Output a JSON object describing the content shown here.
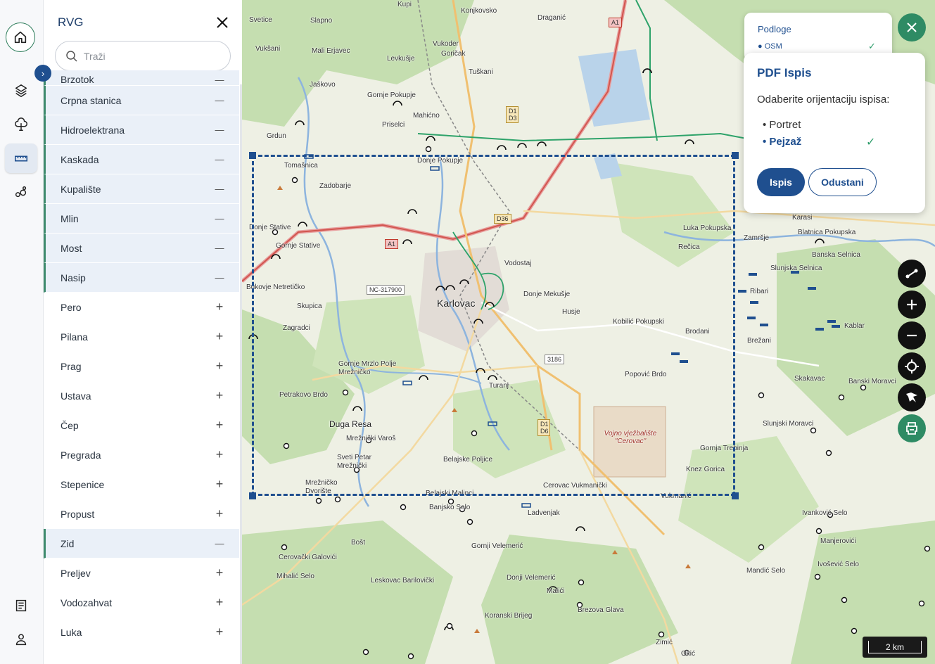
{
  "panel": {
    "title": "RVG",
    "search_placeholder": "Traži",
    "items": [
      {
        "label": "Brzotok",
        "active": true
      },
      {
        "label": "Crpna stanica",
        "active": true
      },
      {
        "label": "Hidroelektrana",
        "active": true
      },
      {
        "label": "Kaskada",
        "active": true
      },
      {
        "label": "Kupalište",
        "active": true
      },
      {
        "label": "Mlin",
        "active": true
      },
      {
        "label": "Most",
        "active": true
      },
      {
        "label": "Nasip",
        "active": true
      },
      {
        "label": "Pero",
        "active": false
      },
      {
        "label": "Pilana",
        "active": false
      },
      {
        "label": "Prag",
        "active": false
      },
      {
        "label": "Ustava",
        "active": false
      },
      {
        "label": "Čep",
        "active": false
      },
      {
        "label": "Pregrada",
        "active": false
      },
      {
        "label": "Stepenice",
        "active": false
      },
      {
        "label": "Propust",
        "active": false
      },
      {
        "label": "Zid",
        "active": true
      },
      {
        "label": "Preljev",
        "active": false
      },
      {
        "label": "Vodozahvat",
        "active": false
      },
      {
        "label": "Luka",
        "active": false
      }
    ]
  },
  "layers": {
    "title": "Podloge",
    "item": "OSM"
  },
  "pdf": {
    "title": "PDF Ispis",
    "question": "Odaberite orijentaciju ispisa:",
    "option_portrait": "• Portret",
    "option_landscape": "• Pejzaž",
    "selected": "Pejzaž",
    "print_button": "Ispis",
    "cancel_button": "Odustani"
  },
  "map": {
    "scale": "2 km",
    "places": {
      "karlovac": "Karlovac",
      "duga_resa": "Duga Resa",
      "turanj": "Turanj",
      "donje_pokupje": "Donje Pokupje",
      "gornje_pokupje": "Gornje Pokupje",
      "tomasnica": "Tomašnica",
      "zadobarje": "Zadobarje",
      "donje_stative": "Donje Stative",
      "gornje_stative": "Gornje Stative",
      "bukovje": "Bukovje Netretičko",
      "skupica": "Skupica",
      "zagradci": "Zagradci",
      "petrakovo_brdo": "Petrakovo Brdo",
      "gornje_mrzlo": "Gornje Mrzlo Polje Mrežničko",
      "vodostaj": "Vodostaj",
      "donje_mekusje": "Donje Mekušje",
      "husje": "Husje",
      "kobilic": "Kobilić Pokupski",
      "brodani": "Brodani",
      "popovic_brdo": "Popović Brdo",
      "luka_pokupska": "Luka Pokupska",
      "recica": "Rečica",
      "zamrsje": "Zamršje",
      "blatnica": "Blatnica Pokupska",
      "banska_selnica": "Banska Selnica",
      "slunjska_selnica": "Slunjska Selnica",
      "ribari": "Ribari",
      "kablar": "Kablar",
      "brezani": "Brežani",
      "skakavac": "Skakavac",
      "vojno": "Vojno vježbalište \"Cerovac\"",
      "gornja_trebinja": "Gornja Trebinja",
      "knez_gorica": "Knez Gorica",
      "cerovac_vukmanicki": "Cerovac Vukmanički",
      "belajske_poljice": "Belajske Poljice",
      "belajski_malinci": "Belajski Malinci",
      "banjsko_selo": "Banjsko Selo",
      "ladvenjak": "Ladvenjak",
      "gornji_velemeric": "Gornji Velemerić",
      "donji_velemeric": "Donji Velemerić",
      "leskovac": "Leskovac Barilovički",
      "bost": "Bošt",
      "mihalic_selo": "Mihalić Selo",
      "cerovacki_galovici": "Cerovački Galovići",
      "koranski_brijeg": "Koranski Brijeg",
      "malici": "Malići",
      "brezova_glava": "Brezova Glava",
      "vukmanic": "Vukmanić",
      "mandic_selo": "Mandić Selo",
      "manjerovici": "Manjerovići",
      "ivanković_selo": "Ivanković Selo",
      "ivoskic_selo": "Ivošević Selo",
      "slunjski_moravci": "Slunjski Moravci",
      "banski_moravci": "Banski Moravci",
      "pecki": "Pečki",
      "zimic": "Zimić",
      "okic": "Okić",
      "sveti_petar": "Sveti Petar Mrežnički",
      "mreznicki_varos": "Mrežnički Varoš",
      "mreznicko_dvoriste": "Mrežničko Dvorište",
      "slapno": "Slapno",
      "svetice": "Svetice",
      "kupi": "Kupi",
      "konjkovsko": "Konjkovsko",
      "draganic": "Draganić",
      "vukoder": "Vukoder",
      "goricak": "Goričak",
      "tuskani": "Tuškani",
      "mahicno": "Mahićno",
      "priselci": "Priselci",
      "grdun": "Grdun",
      "levkusje": "Levkušje",
      "jaskovo": "Jaškovo",
      "mali_erjavec": "Mali Erjavec",
      "vuksani": "Vukšani",
      "karasi": "Karasi"
    },
    "shields": {
      "a1_top": "A1",
      "a1_mid": "A1",
      "d1d3": "D1 D3",
      "d36": "D36",
      "nc": "NC-317900",
      "r3186": "3186",
      "d1d6": "D1 D6"
    }
  },
  "colors": {
    "accent": "#1f4f8f",
    "green": "#2e8b64",
    "active_row": "#eaf0f8"
  }
}
